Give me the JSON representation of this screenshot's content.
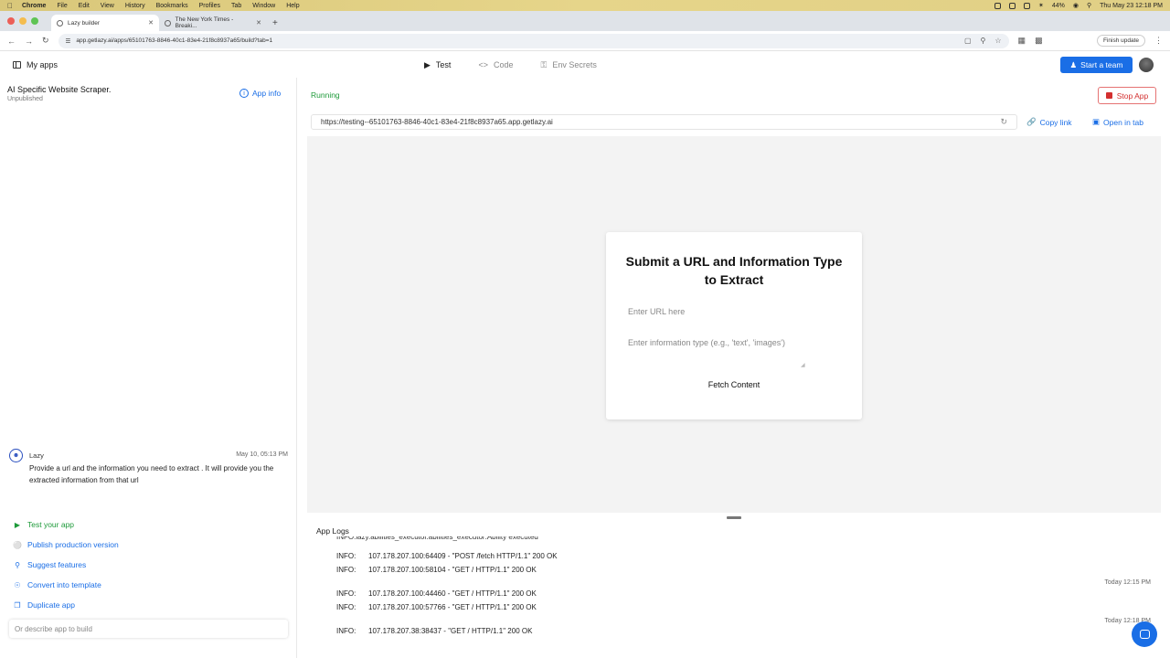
{
  "menubar": {
    "app": "Chrome",
    "items": [
      "File",
      "Edit",
      "View",
      "History",
      "Bookmarks",
      "Profiles",
      "Tab",
      "Window",
      "Help"
    ],
    "battery": "44%",
    "datetime": "Thu May 23  12:18 PM"
  },
  "tabs": [
    {
      "title": "Lazy builder"
    },
    {
      "title": "The New York Times - Breaki..."
    }
  ],
  "addressbar": {
    "url": "app.getlazy.ai/apps/65101763-8846-40c1-83e4-21f8c8937a65/build?tab=1",
    "finish_update": "Finish update"
  },
  "header": {
    "my_apps": "My apps",
    "tabs": [
      "Test",
      "Code",
      "Env Secrets"
    ],
    "start_team": "Start a team"
  },
  "left": {
    "app_title": "AI Specific Website Scraper.",
    "app_status": "Unpublished",
    "app_info": "App info",
    "message": {
      "author": "Lazy",
      "time": "May 10, 05:13 PM",
      "text": "Provide a url and the information you need to extract . It will provide you the extracted information from that url"
    },
    "actions": [
      "Test your app",
      "Publish production version",
      "Suggest features",
      "Convert into template",
      "Duplicate app"
    ],
    "input_placeholder": "Or describe app to build"
  },
  "right": {
    "status": "Running",
    "stop_app": "Stop App",
    "preview_url": "https://testing--65101763-8846-40c1-83e4-21f8c8937a65.app.getlazy.ai",
    "copy_link": "Copy link",
    "open_in_tab": "Open in tab",
    "form": {
      "title": "Submit a URL and Information Type to Extract",
      "url_placeholder": "Enter URL here",
      "info_placeholder": "Enter information type (e.g., 'text', 'images')",
      "button": "Fetch Content"
    },
    "logs": {
      "title": "App Logs",
      "cut_line": "INFO:lazy.abilities_executor.abilities_executor:Ability executed",
      "lines": [
        {
          "level": "INFO:",
          "text": "107.178.207.100:64409 - \"POST /fetch HTTP/1.1\" 200 OK"
        },
        {
          "level": "INFO:",
          "text": "107.178.207.100:58104 - \"GET / HTTP/1.1\" 200 OK"
        },
        {
          "level": "INFO:",
          "text": "107.178.207.100:44460 - \"GET / HTTP/1.1\" 200 OK"
        },
        {
          "level": "INFO:",
          "text": "107.178.207.100:57766 - \"GET / HTTP/1.1\" 200 OK"
        },
        {
          "level": "INFO:",
          "text": "107.178.207.38:38437 - \"GET / HTTP/1.1\" 200 OK"
        }
      ],
      "timestamps": [
        "Today 12:15 PM",
        "Today 12:18 PM"
      ]
    }
  }
}
